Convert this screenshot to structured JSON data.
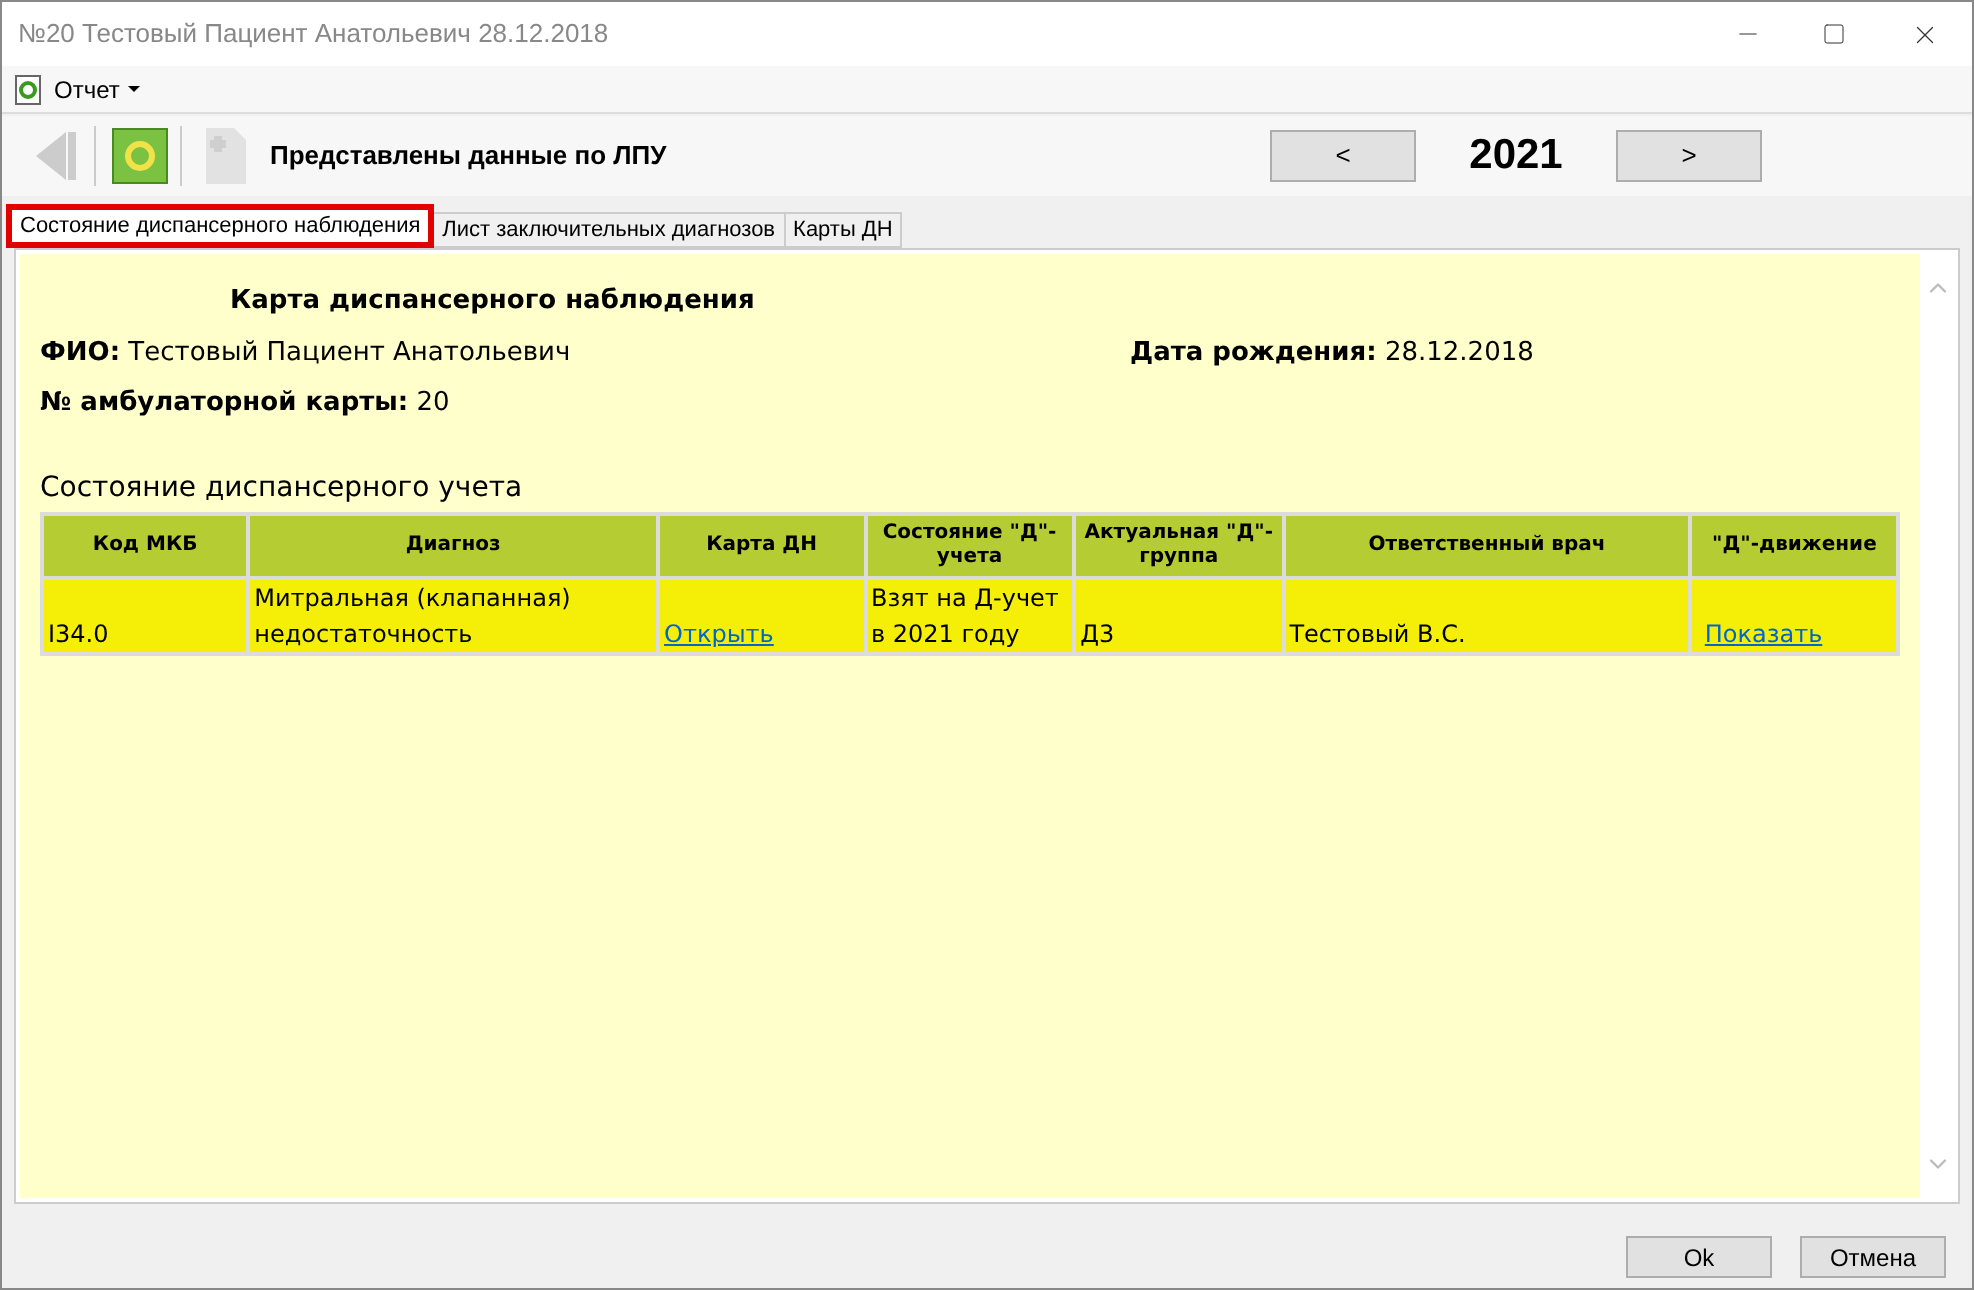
{
  "window": {
    "title": "№20 Тестовый Пациент Анатольевич 28.12.2018"
  },
  "menu": [
    {
      "label": "Отчет"
    }
  ],
  "toolbar": {
    "status": "Представлены данные по ЛПУ",
    "year": "2021",
    "prev": "<",
    "next": ">"
  },
  "tabs": [
    {
      "label": "Состояние диспансерного наблюдения",
      "selected": true
    },
    {
      "label": "Лист заключительных диагнозов",
      "selected": false
    },
    {
      "label": "Карты ДН",
      "selected": false
    }
  ],
  "card": {
    "title": "Карта диспансерного наблюдения",
    "fio": "**ФИО:** Тестовый Пациент Анатольевич",
    "birth": "**Дата рождения:** 28.12.2018",
    "card_no": "**№ амбулаторной карты:** 20",
    "section": "Состояние диспансерного учета"
  },
  "table": {
    "columns": [
      "Код МКБ",
      "Диагноз",
      "Карта ДН",
      "Состояние \"Д\"-учета",
      "Актуальная \"Д\"-группа",
      "Ответственный врач",
      "\"Д\"-движение"
    ],
    "rows": [
      {
        "cells": [
          {
            "kind": "text",
            "text": "I34.0"
          },
          {
            "kind": "text",
            "text": "Митральная (клапанная) недостаточность"
          },
          {
            "kind": "link",
            "text": "Открыть"
          },
          {
            "kind": "text",
            "text": "Взят на Д-учет в 2021 году"
          },
          {
            "kind": "text",
            "text": "Д3"
          },
          {
            "kind": "text",
            "text": "Тестовый В.С."
          },
          {
            "kind": "link",
            "text": "Показать"
          }
        ]
      }
    ]
  },
  "buttons": [
    "Ok",
    "Отмена"
  ]
}
